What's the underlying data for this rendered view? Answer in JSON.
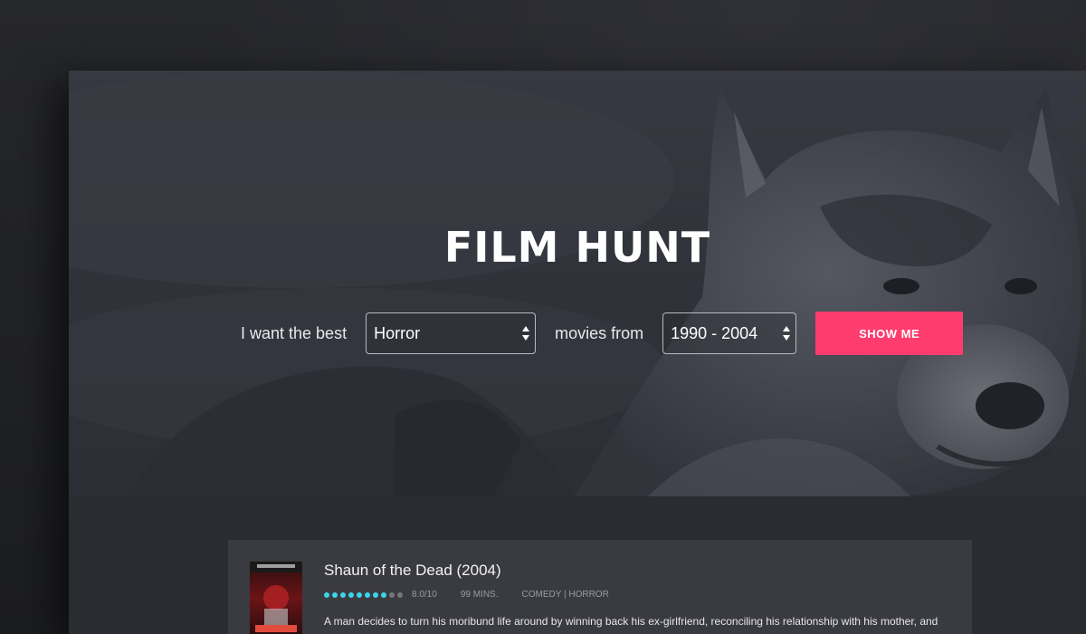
{
  "app": {
    "title": "FILM HUNT"
  },
  "search": {
    "prefix_label": "I want the best",
    "genre_value": "Horror",
    "middle_label": "movies from",
    "years_value": "1990 - 2004",
    "button_label": "SHOW ME"
  },
  "results": [
    {
      "title": "Shaun of the Dead (2004)",
      "rating_value": 8.0,
      "rating_text": "8.0/10",
      "runtime": "99 MINS.",
      "genres": "COMEDY | HORROR",
      "description": "A man decides to turn his moribund life around by winning back his ex-girlfriend, reconciling his relationship with his mother, and"
    }
  ],
  "colors": {
    "accent": "#ff3c6e",
    "star_filled": "#3ad6e8",
    "star_empty": "#76777e",
    "hero_bg": "#383a42",
    "page_bg": "#2b2c31",
    "card_bg": "#3a3b40"
  },
  "icons": {
    "select_arrows": "up-down-arrows-icon",
    "rating": "star-icon",
    "hero": "husky-photo"
  }
}
